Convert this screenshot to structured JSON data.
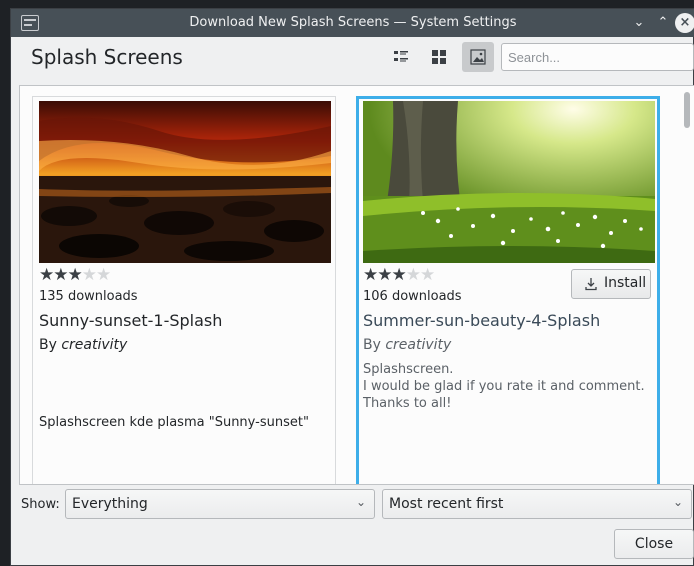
{
  "window": {
    "title": "Download New Splash Screens — System Settings"
  },
  "header": {
    "title": "Splash Screens",
    "search_placeholder": "Search..."
  },
  "view_modes": [
    {
      "icon": "detail-list-icon",
      "active": false
    },
    {
      "icon": "tile-grid-icon",
      "active": false
    },
    {
      "icon": "image-preview-icon",
      "active": true
    }
  ],
  "items": [
    {
      "rating": 3,
      "max_rating": 5,
      "downloads": "135 downloads",
      "name": "Sunny-sunset-1-Splash",
      "author_prefix": "By",
      "author": "creativity",
      "description": "Splashscreen kde plasma \"Sunny-sunset\"",
      "selected": false
    },
    {
      "rating": 3,
      "max_rating": 5,
      "downloads": "106 downloads",
      "name": "Summer-sun-beauty-4-Splash",
      "author_prefix": "By",
      "author": "creativity",
      "description_lines": [
        "Splashscreen.",
        "I would be glad if you rate it and comment.",
        "Thanks to all!"
      ],
      "install_label": "Install",
      "selected": true
    }
  ],
  "footer": {
    "show_label": "Show:",
    "filter_value": "Everything",
    "sort_value": "Most recent first",
    "close_label": "Close"
  },
  "colors": {
    "accent": "#3daee9",
    "titlebar": "#475057"
  }
}
